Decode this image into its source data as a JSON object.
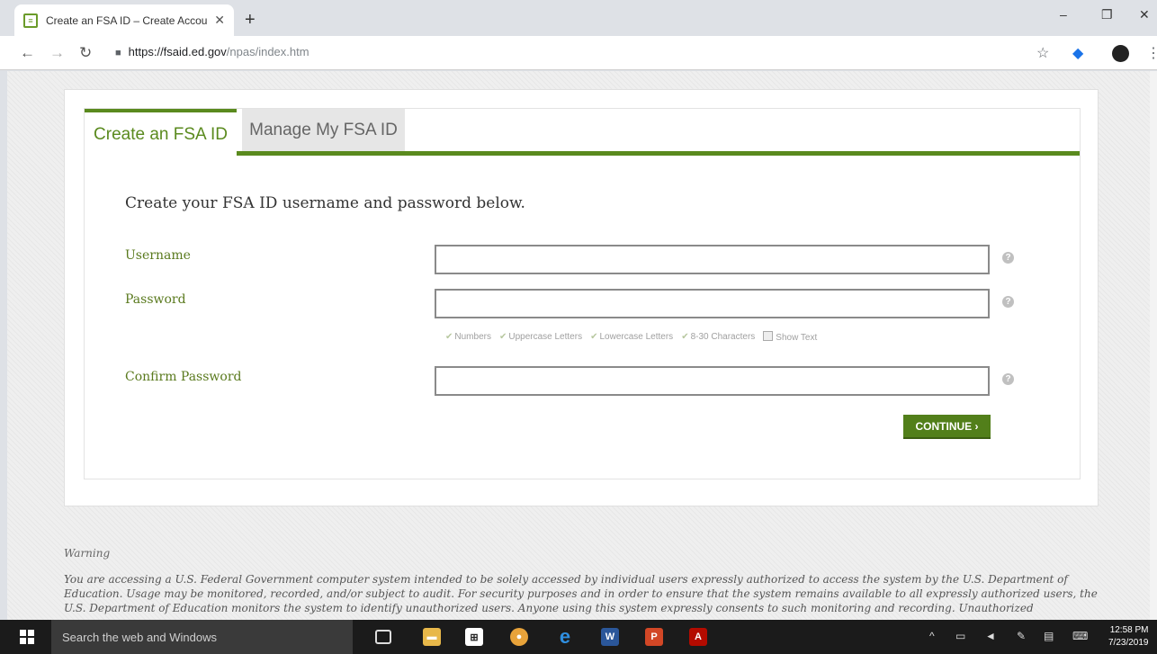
{
  "browser": {
    "tab_title": "Create an FSA ID – Create Accou",
    "new_tab": "+",
    "url_domain": "https://fsaid.ed.gov",
    "url_path": "/npas/index.htm",
    "minimize": "–",
    "maximize": "❐",
    "close": "✕"
  },
  "tabs": {
    "create_label": "Create an FSA ID",
    "manage_label": "Manage My FSA ID"
  },
  "form": {
    "heading": "Create your FSA ID username and password below.",
    "username_label": "Username",
    "password_label": "Password",
    "confirm_label": "Confirm Password",
    "username_value": "",
    "password_value": "",
    "confirm_value": "",
    "requirements": {
      "numbers": "Numbers",
      "uppercase": "Uppercase Letters",
      "lowercase": "Lowercase Letters",
      "length": "8-30 Characters",
      "show_text": "Show Text"
    },
    "continue_label": "CONTINUE ›",
    "help_glyph": "?"
  },
  "warning": {
    "title": "Warning",
    "text": "You are accessing a U.S. Federal Government computer system intended to be solely accessed by individual users expressly authorized to access the system by the U.S. Department of Education. Usage may be monitored, recorded, and/or subject to audit. For security purposes and in order to ensure that the system remains available to all expressly authorized users, the U.S. Department of Education monitors the system to identify unauthorized users. Anyone using this system expressly consents to such monitoring and recording. Unauthorized"
  },
  "taskbar": {
    "search_placeholder": "Search the web and Windows",
    "time": "12:58 PM",
    "date": "7/23/2019"
  },
  "icons": [
    "back-icon",
    "forward-icon",
    "reload-icon",
    "lock-icon",
    "star-icon",
    "extension-icon",
    "menu-icon",
    "help-icon",
    "windows-start-icon"
  ]
}
